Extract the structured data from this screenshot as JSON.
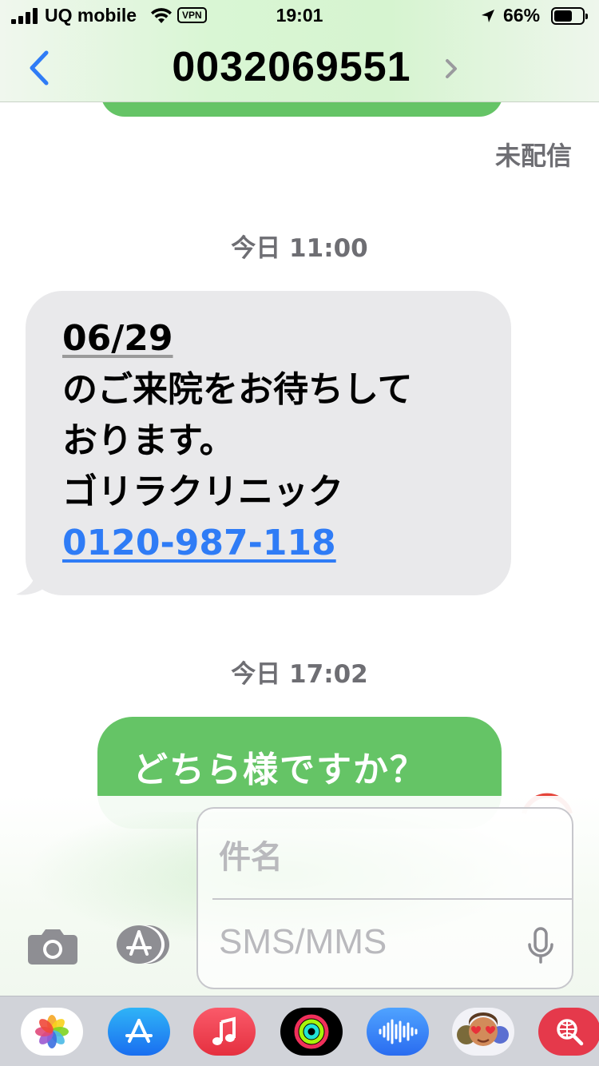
{
  "status_bar": {
    "carrier": "UQ mobile",
    "vpn": "VPN",
    "time": "19:01",
    "battery": "66%",
    "battery_level": 0.66
  },
  "nav": {
    "title": "0032069551"
  },
  "conversation": {
    "undelivered_label": "未配信",
    "groups": [
      {
        "timestamp": "今日 11:00",
        "incoming_message": {
          "date": "06/29",
          "line2": "のご来院をお待ちして",
          "line3": "おります。",
          "line4": "ゴリラクリニック",
          "phone": "0120-987-118"
        }
      },
      {
        "timestamp": "今日 17:02",
        "outgoing_message": "どちら様ですか？"
      }
    ]
  },
  "compose": {
    "subject_placeholder": "件名",
    "message_placeholder": "SMS/MMS"
  },
  "app_drawer": {
    "apps": [
      "photos-icon",
      "app-store-icon",
      "music-icon",
      "fitness-icon",
      "audio-messages-icon",
      "memoji-icon",
      "web-search-icon"
    ]
  },
  "colors": {
    "outgoing_bubble": "#65c466",
    "incoming_bubble": "#e9e9eb",
    "link": "#2f7cf6",
    "back_arrow": "#2f7cf6",
    "timestamp": "#6e6e73"
  }
}
